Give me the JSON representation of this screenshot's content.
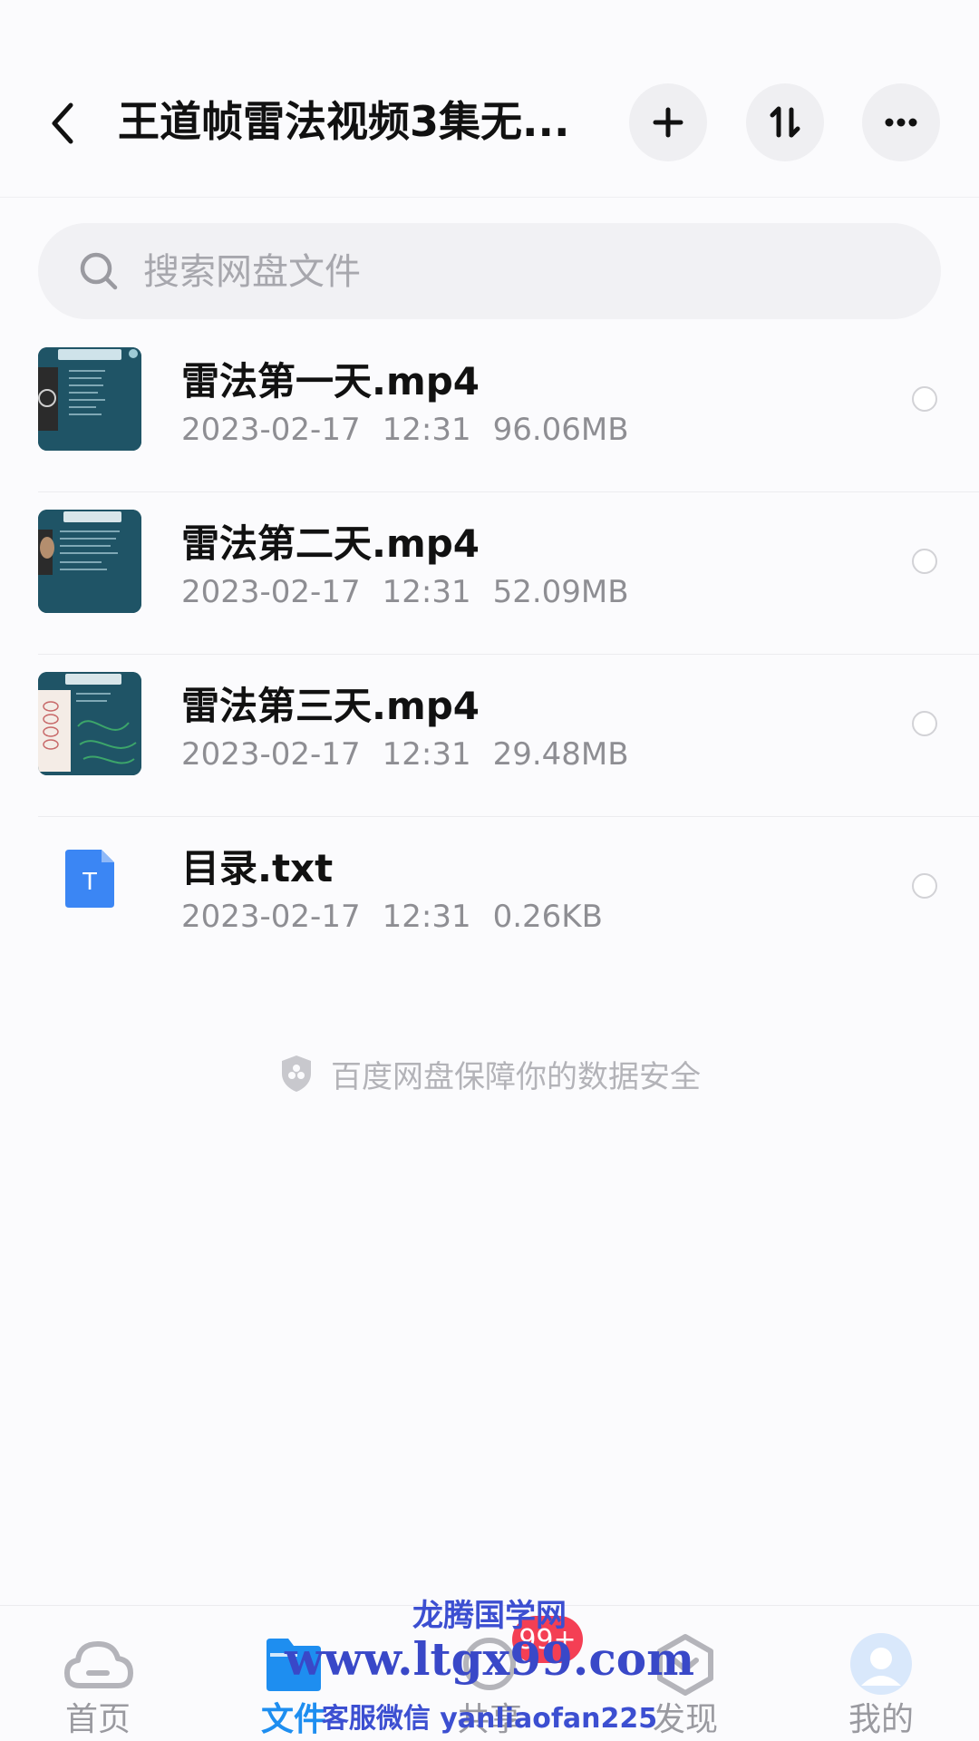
{
  "header": {
    "title": "王道帧雷法视频3集无...",
    "back_icon": "chevron-left-icon",
    "add_icon": "plus-icon",
    "sort_icon": "sort-icon",
    "more_icon": "more-icon"
  },
  "search": {
    "placeholder": "搜索网盘文件",
    "icon": "search-icon"
  },
  "files": [
    {
      "name": "雷法第一天.mp4",
      "date": "2023-02-17",
      "time": "12:31",
      "size": "96.06MB",
      "type": "video"
    },
    {
      "name": "雷法第二天.mp4",
      "date": "2023-02-17",
      "time": "12:31",
      "size": "52.09MB",
      "type": "video"
    },
    {
      "name": "雷法第三天.mp4",
      "date": "2023-02-17",
      "time": "12:31",
      "size": "29.48MB",
      "type": "video"
    },
    {
      "name": "目录.txt",
      "date": "2023-02-17",
      "time": "12:31",
      "size": "0.26KB",
      "type": "text",
      "icon_letter": "T"
    }
  ],
  "security_note": "百度网盘保障你的数据安全",
  "nav": {
    "items": [
      {
        "label": "首页",
        "icon": "cloud-icon",
        "active": false
      },
      {
        "label": "文件",
        "icon": "folder-icon",
        "active": true
      },
      {
        "label": "共享",
        "icon": "share-icon",
        "active": false
      },
      {
        "label": "发现",
        "icon": "discover-icon",
        "active": false
      },
      {
        "label": "我的",
        "icon": "avatar-icon",
        "active": false
      }
    ],
    "badge": "99+"
  },
  "watermark": {
    "line1": "龙腾国学网",
    "line2": "www.ltgx99.com",
    "line3": "客服微信 yanliaofan225"
  },
  "colors": {
    "accent": "#1e8ef0",
    "badge": "#f43f54",
    "doc_icon": "#3b86f4"
  }
}
